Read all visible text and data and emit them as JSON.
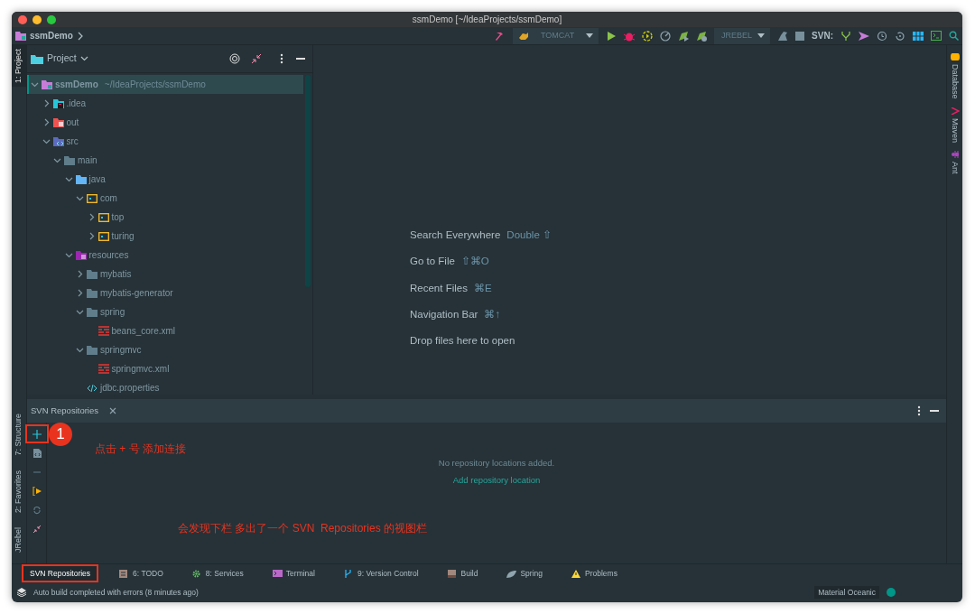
{
  "window": {
    "title": "ssmDemo [~/IdeaProjects/ssmDemo]"
  },
  "breadcrumb": [
    {
      "label": "ssmDemo"
    }
  ],
  "toolbar": {
    "run_config": "TOMCAT",
    "jrebel_config": "JREBEL",
    "svn_label": "SVN:"
  },
  "left_tool_tabs": {
    "top": [
      {
        "label": "1: Project",
        "selected": true
      }
    ],
    "bottom": [
      {
        "label": "7: Structure",
        "selected": false
      },
      {
        "label": "2: Favorites",
        "selected": false
      },
      {
        "label": "JRebel",
        "selected": false
      }
    ]
  },
  "right_tool_tabs": [
    {
      "label": "Database",
      "kind": "database"
    },
    {
      "label": "Maven",
      "kind": "maven"
    },
    {
      "label": "Ant",
      "kind": "ant"
    }
  ],
  "project_panel": {
    "title": "Project",
    "tree": [
      {
        "label": "ssmDemo",
        "path": "~/IdeaProjects/ssmDemo",
        "kind": "module",
        "expanded": true,
        "selected": true,
        "children": [
          {
            "label": ".idea",
            "kind": "idea",
            "expanded": false,
            "selected": false
          },
          {
            "label": "out",
            "kind": "excluded",
            "expanded": false,
            "selected": false
          },
          {
            "label": "src",
            "kind": "source-root",
            "expanded": true,
            "selected": false,
            "children": [
              {
                "label": "main",
                "kind": "folder",
                "expanded": true,
                "selected": false,
                "children": [
                  {
                    "label": "java",
                    "kind": "java",
                    "expanded": true,
                    "selected": false,
                    "children": [
                      {
                        "label": "com",
                        "kind": "package",
                        "expanded": true,
                        "selected": false,
                        "children": [
                          {
                            "label": "top",
                            "kind": "package",
                            "expanded": false,
                            "selected": false
                          },
                          {
                            "label": "turing",
                            "kind": "package",
                            "expanded": false,
                            "selected": false
                          }
                        ]
                      }
                    ]
                  },
                  {
                    "label": "resources",
                    "kind": "resources",
                    "expanded": true,
                    "selected": false,
                    "children": [
                      {
                        "label": "mybatis",
                        "kind": "folder",
                        "expanded": false,
                        "selected": false
                      },
                      {
                        "label": "mybatis-generator",
                        "kind": "folder",
                        "expanded": false,
                        "selected": false
                      },
                      {
                        "label": "spring",
                        "kind": "folder",
                        "expanded": true,
                        "selected": false,
                        "children": [
                          {
                            "label": "beans_core.xml",
                            "kind": "xml",
                            "selected": false
                          }
                        ]
                      },
                      {
                        "label": "springmvc",
                        "kind": "folder",
                        "expanded": true,
                        "selected": false,
                        "children": [
                          {
                            "label": "springmvc.xml",
                            "kind": "xml",
                            "selected": false
                          }
                        ]
                      },
                      {
                        "label": "jdbc.properties",
                        "kind": "properties",
                        "selected": false
                      }
                    ]
                  }
                ]
              }
            ]
          }
        ]
      }
    ]
  },
  "editor": {
    "hints": [
      {
        "label": "Search Everywhere",
        "shortcut": "Double ⇧"
      },
      {
        "label": "Go to File",
        "shortcut": "⇧⌘O"
      },
      {
        "label": "Recent Files",
        "shortcut": "⌘E"
      },
      {
        "label": "Navigation Bar",
        "shortcut": "⌘↑"
      },
      {
        "label": "Drop files here to open"
      }
    ]
  },
  "svn_panel": {
    "tab": "SVN Repositories",
    "tools": [
      {
        "kind": "add",
        "highlighted": true
      },
      {
        "kind": "file",
        "highlighted": false
      },
      {
        "kind": "remove",
        "highlighted": false
      },
      {
        "kind": "run",
        "highlighted": false
      },
      {
        "kind": "refresh",
        "highlighted": false
      },
      {
        "kind": "collapse",
        "highlighted": false
      }
    ],
    "empty_text": "No repository locations added.",
    "link": "Add repository location"
  },
  "annotations": [
    {
      "kind": "badge",
      "text": "1"
    },
    {
      "kind": "note",
      "text": "点击 + 号 添加连接"
    },
    {
      "kind": "note",
      "text": "会发现下栏 多出了一个 SVN  Repositories 的视图栏"
    }
  ],
  "bottom_tabs": [
    {
      "label": "SVN Repositories",
      "kind": "svn",
      "selected": true,
      "highlighted": true
    },
    {
      "label": "6: TODO",
      "kind": "todo",
      "selected": false,
      "highlighted": false
    },
    {
      "label": "8: Services",
      "kind": "services",
      "selected": false,
      "highlighted": false
    },
    {
      "label": "Terminal",
      "kind": "terminal",
      "selected": false,
      "highlighted": false
    },
    {
      "label": "9: Version Control",
      "kind": "vcs",
      "selected": false,
      "highlighted": false
    },
    {
      "label": "Build",
      "kind": "build",
      "selected": false,
      "highlighted": false
    },
    {
      "label": "Spring",
      "kind": "spring",
      "selected": false,
      "highlighted": false
    },
    {
      "label": "Problems",
      "kind": "problems",
      "selected": false,
      "highlighted": false
    }
  ],
  "status_bar": {
    "message": "Auto build completed with errors (8 minutes ago)",
    "theme": "Material Oceanic"
  }
}
